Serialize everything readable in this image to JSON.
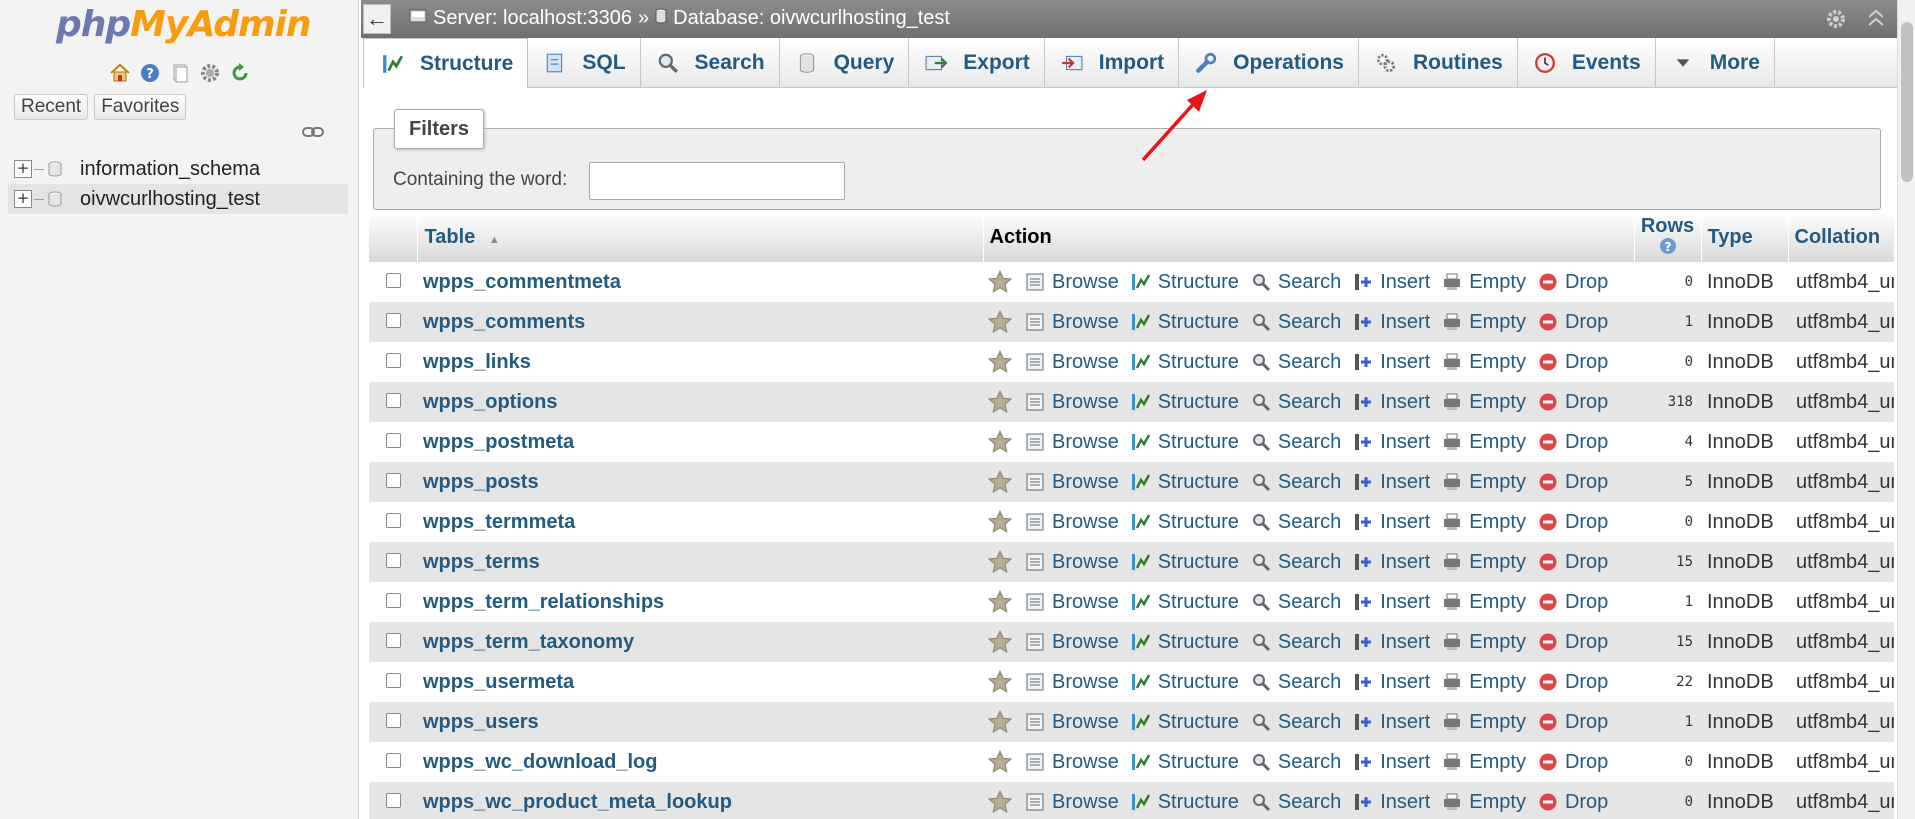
{
  "navigation": {
    "logo": {
      "part1": "php",
      "part2": "MyAdmin"
    },
    "icons": [
      "home-icon",
      "help-icon",
      "docs-icon",
      "settings-icon",
      "reload-icon"
    ],
    "recent_label": "Recent",
    "favorites_label": "Favorites",
    "databases": [
      {
        "name": "information_schema",
        "selected": false
      },
      {
        "name": "oivwcurlhosting_test",
        "selected": true
      }
    ]
  },
  "topbar": {
    "back_label": "←",
    "server": "Server: localhost:3306",
    "separator": "»",
    "database": "Database: oivwcurlhosting_test"
  },
  "tabs": [
    {
      "label": "Structure",
      "icon": "structure-icon",
      "active": true
    },
    {
      "label": "SQL",
      "icon": "sql-icon",
      "active": false
    },
    {
      "label": "Search",
      "icon": "search-icon",
      "active": false
    },
    {
      "label": "Query",
      "icon": "query-icon",
      "active": false
    },
    {
      "label": "Export",
      "icon": "export-icon",
      "active": false
    },
    {
      "label": "Import",
      "icon": "import-icon",
      "active": false
    },
    {
      "label": "Operations",
      "icon": "wrench-icon",
      "active": false
    },
    {
      "label": "Routines",
      "icon": "routines-icon",
      "active": false
    },
    {
      "label": "Events",
      "icon": "clock-icon",
      "active": false
    },
    {
      "label": "More",
      "icon": "chevron-down-icon",
      "active": false
    }
  ],
  "filters": {
    "legend": "Filters",
    "label": "Containing the word:",
    "value": ""
  },
  "table": {
    "headers": {
      "table": "Table",
      "sort_indicator": "▲",
      "action": "Action",
      "rows": "Rows",
      "type": "Type",
      "collation": "Collation"
    },
    "actions": [
      "Browse",
      "Structure",
      "Search",
      "Insert",
      "Empty",
      "Drop"
    ],
    "rows": [
      {
        "name": "wpps_commentmeta",
        "rows": "0",
        "type": "InnoDB",
        "collation": "utf8mb4_un"
      },
      {
        "name": "wpps_comments",
        "rows": "1",
        "type": "InnoDB",
        "collation": "utf8mb4_un"
      },
      {
        "name": "wpps_links",
        "rows": "0",
        "type": "InnoDB",
        "collation": "utf8mb4_un"
      },
      {
        "name": "wpps_options",
        "rows": "318",
        "type": "InnoDB",
        "collation": "utf8mb4_un"
      },
      {
        "name": "wpps_postmeta",
        "rows": "4",
        "type": "InnoDB",
        "collation": "utf8mb4_un"
      },
      {
        "name": "wpps_posts",
        "rows": "5",
        "type": "InnoDB",
        "collation": "utf8mb4_un"
      },
      {
        "name": "wpps_termmeta",
        "rows": "0",
        "type": "InnoDB",
        "collation": "utf8mb4_un"
      },
      {
        "name": "wpps_terms",
        "rows": "15",
        "type": "InnoDB",
        "collation": "utf8mb4_un"
      },
      {
        "name": "wpps_term_relationships",
        "rows": "1",
        "type": "InnoDB",
        "collation": "utf8mb4_un"
      },
      {
        "name": "wpps_term_taxonomy",
        "rows": "15",
        "type": "InnoDB",
        "collation": "utf8mb4_un"
      },
      {
        "name": "wpps_usermeta",
        "rows": "22",
        "type": "InnoDB",
        "collation": "utf8mb4_un"
      },
      {
        "name": "wpps_users",
        "rows": "1",
        "type": "InnoDB",
        "collation": "utf8mb4_un"
      },
      {
        "name": "wpps_wc_download_log",
        "rows": "0",
        "type": "InnoDB",
        "collation": "utf8mb4_un"
      },
      {
        "name": "wpps_wc_product_meta_lookup",
        "rows": "0",
        "type": "InnoDB",
        "collation": "utf8mb4_un"
      }
    ]
  },
  "colors": {
    "link": "#235a81",
    "logo_php": "#6c78af",
    "logo_myadmin": "#f89c0e",
    "arrow": "#e8151b",
    "drop": "#e04545"
  }
}
